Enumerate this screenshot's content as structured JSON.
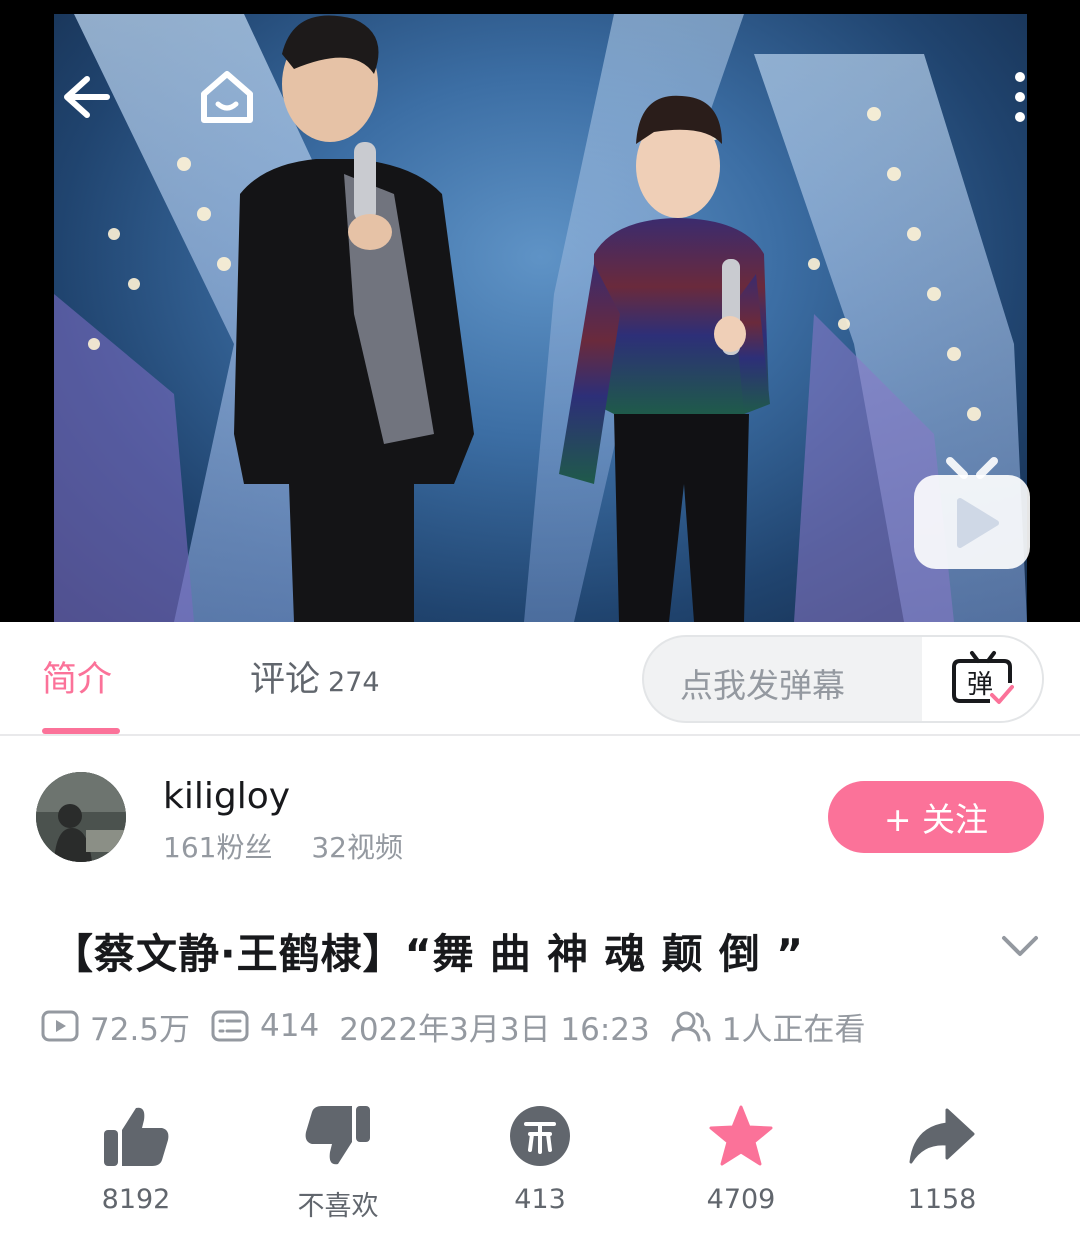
{
  "video": {
    "back_icon": "arrow-left-icon",
    "home_icon": "home-icon",
    "more_icon": "more-vertical-icon",
    "mini_player_icon": "tv-play-icon"
  },
  "tabs": {
    "intro_label": "简介",
    "comments_label": "评论",
    "comments_count": "274"
  },
  "danmaku": {
    "placeholder": "点我发弹幕",
    "toggle_icon": "danmaku-toggle-icon",
    "toggle_glyph": "弹"
  },
  "uploader": {
    "name": "kiligloy",
    "fans": "161粉丝",
    "videos": "32视频",
    "follow_label": "+ 关注"
  },
  "video_info": {
    "title": "【蔡文静·王鹤棣】“舞 曲  神 魂 颠 倒 ”",
    "views": "72.5万",
    "danmaku_count": "414",
    "publish_time": "2022年3月3日 16:23",
    "watching": "1人正在看"
  },
  "actions": [
    {
      "name": "like",
      "icon": "thumbs-up-icon",
      "label": "8192"
    },
    {
      "name": "dislike",
      "icon": "thumbs-down-icon",
      "label": "不喜欢"
    },
    {
      "name": "coin",
      "icon": "coin-icon",
      "label": "413"
    },
    {
      "name": "favorite",
      "icon": "star-icon",
      "label": "4709"
    },
    {
      "name": "share",
      "icon": "share-icon",
      "label": "1158"
    }
  ],
  "colors": {
    "accent": "#fb7299",
    "text_primary": "#18191c",
    "text_secondary": "#9499a0",
    "icon_gray": "#61666d"
  }
}
